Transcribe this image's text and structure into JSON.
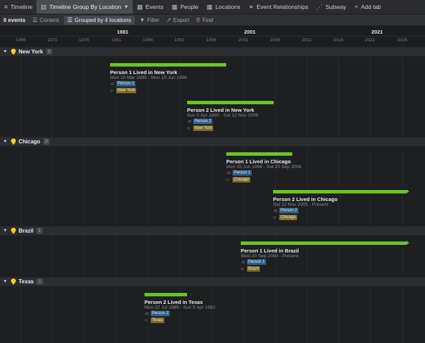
{
  "tabs": [
    {
      "label": "Timeline",
      "icon": "timeline-icon"
    },
    {
      "label": "Timeline Group By Location",
      "icon": "timeline-group-icon",
      "active": true
    },
    {
      "label": "Events",
      "icon": "table-icon"
    },
    {
      "label": "People",
      "icon": "table-icon"
    },
    {
      "label": "Locations",
      "icon": "table-icon"
    },
    {
      "label": "Event Relationships",
      "icon": "relationship-icon"
    },
    {
      "label": "Subway",
      "icon": "subway-icon"
    },
    {
      "label": "Add tab",
      "icon": "plus-icon"
    }
  ],
  "toolbar": {
    "count": "6 events",
    "content": "Content",
    "grouped": "Grouped by 4 locations",
    "filter": "Filter",
    "export": "Export",
    "find": "Find"
  },
  "ruler": {
    "majors": [
      "1981",
      "2001",
      "2021"
    ],
    "minors": [
      "1966",
      "1971",
      "1976",
      "1981",
      "1986",
      "1991",
      "1996",
      "2001",
      "2006",
      "2011",
      "2016",
      "2021",
      "2026"
    ]
  },
  "groups": [
    {
      "name": "New York",
      "count": "2"
    },
    {
      "name": "Chicago",
      "count": "2"
    },
    {
      "name": "Brazil",
      "count": "1"
    },
    {
      "name": "Texas",
      "count": "1"
    }
  ],
  "events": [
    {
      "title": "Person 1 Lived in New York",
      "date": "Mon 10 Mar 1980 - Mon 15 Jun 1998",
      "person": "Person 1",
      "location": "New York"
    },
    {
      "title": "Person 2 Lived in New York",
      "date": "Sun 5 Apr 1992 - Sat 12 Nov 2005",
      "person": "Person 2",
      "location": "New York"
    },
    {
      "title": "Person 1 Lived in Chicago",
      "date": "Mon 15 Jun 1998 - Sat 20 Sep 2008",
      "person": "Person 1",
      "location": "Chicago"
    },
    {
      "title": "Person 2 Lived in Chicago",
      "date": "Sat 12 Nov 2005 - Present",
      "person": "Person 2",
      "location": "Chicago"
    },
    {
      "title": "Person 1 Lived in Brazil",
      "date": "Wed 20 Sep 2000 - Present",
      "person": "Person 1",
      "location": "Brazil"
    },
    {
      "title": "Person 2 Lived in Texas",
      "date": "Mon 22 Jul 1985 - Sun 5 Apr 1992",
      "person": "Person 2",
      "location": "Texas"
    }
  ],
  "colors": {
    "bar": "#6cc51f",
    "person_badge": "#2f5f86",
    "location_badge": "#7d6a2b",
    "pin": "#f2d21b"
  }
}
